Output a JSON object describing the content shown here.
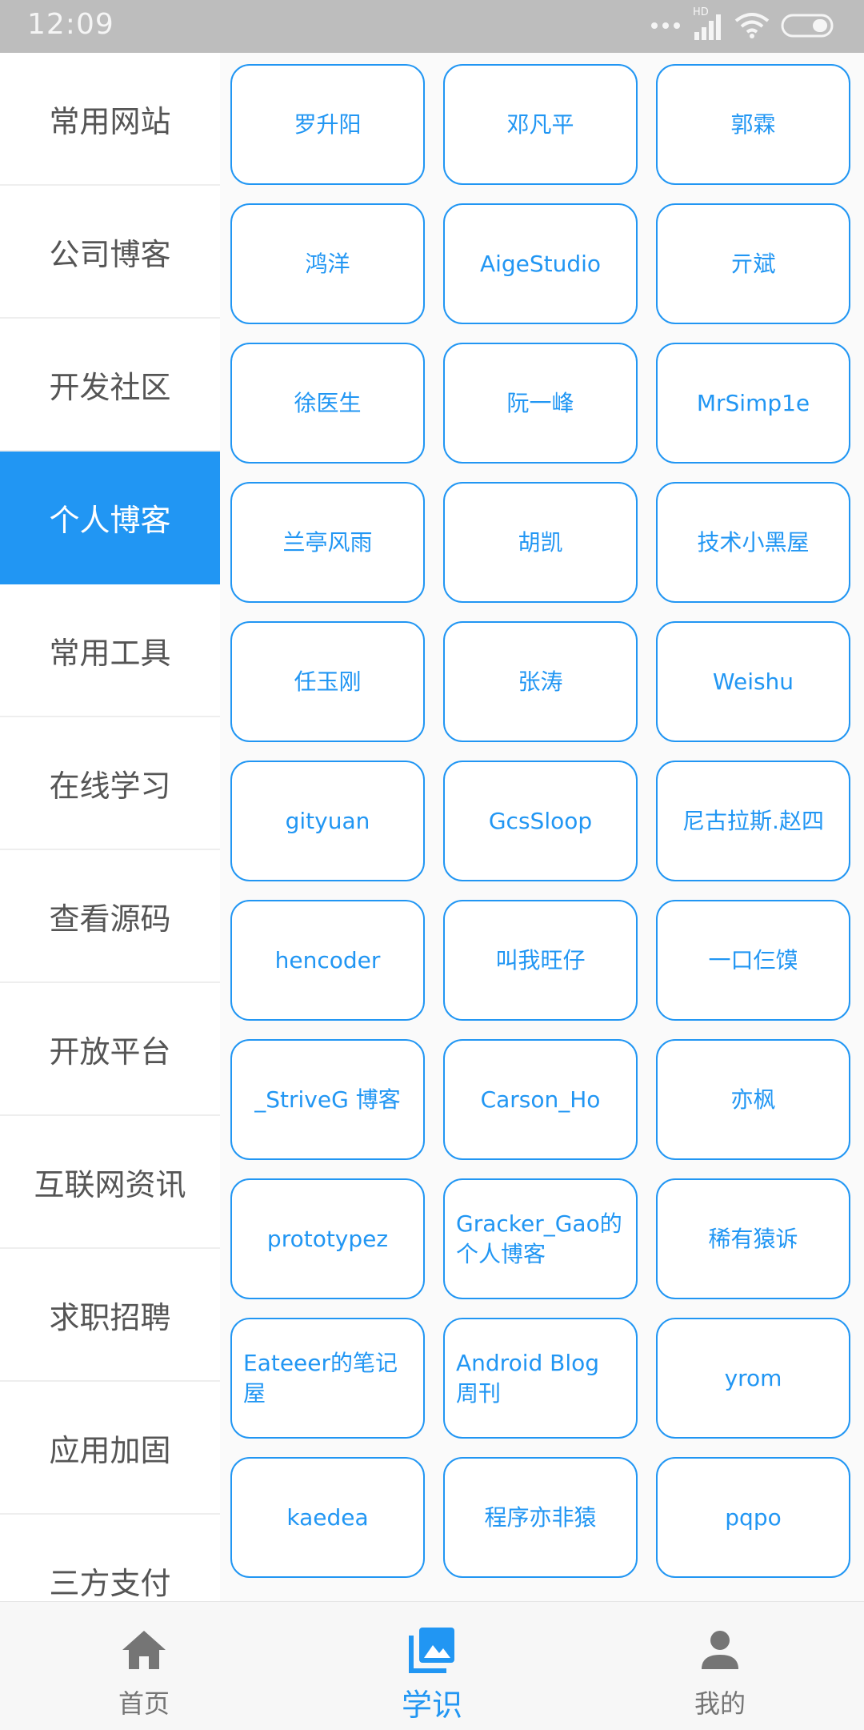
{
  "status_bar": {
    "time": "12:09",
    "network_badge": "HD"
  },
  "sidebar": {
    "items": [
      {
        "label": "常用网站",
        "active": false
      },
      {
        "label": "公司博客",
        "active": false
      },
      {
        "label": "开发社区",
        "active": false
      },
      {
        "label": "个人博客",
        "active": true
      },
      {
        "label": "常用工具",
        "active": false
      },
      {
        "label": "在线学习",
        "active": false
      },
      {
        "label": "查看源码",
        "active": false
      },
      {
        "label": "开放平台",
        "active": false
      },
      {
        "label": "互联网资讯",
        "active": false
      },
      {
        "label": "求职招聘",
        "active": false
      },
      {
        "label": "应用加固",
        "active": false
      },
      {
        "label": "三方支付",
        "active": false
      }
    ]
  },
  "grid": {
    "items": [
      "罗升阳",
      "邓凡平",
      "郭霖",
      "鸿洋",
      "AigeStudio",
      "亓斌",
      "徐医生",
      "阮一峰",
      "MrSimp1e",
      "兰亭风雨",
      "胡凯",
      "技术小黑屋",
      "任玉刚",
      "张涛",
      "Weishu",
      "gityuan",
      "GcsSloop",
      "尼古拉斯.赵四",
      "hencoder",
      "叫我旺仔",
      "一口仨馍",
      "_StriveG 博客",
      "Carson_Ho",
      "亦枫",
      "prototypez",
      "Gracker_Gao的个人博客",
      "稀有猿诉",
      "Eateeer的笔记屋",
      "Android Blog 周刊",
      "yrom",
      "kaedea",
      "程序亦非猿",
      "pqpo"
    ]
  },
  "bottom_nav": {
    "items": [
      {
        "label": "首页",
        "icon": "home-icon",
        "active": false
      },
      {
        "label": "学识",
        "icon": "photo-library-icon",
        "active": true
      },
      {
        "label": "我的",
        "icon": "person-icon",
        "active": false
      }
    ]
  },
  "colors": {
    "accent": "#2196f3",
    "status_bar": "#bdbdbd",
    "sidebar_text": "#555555",
    "nav_inactive": "#757575"
  }
}
